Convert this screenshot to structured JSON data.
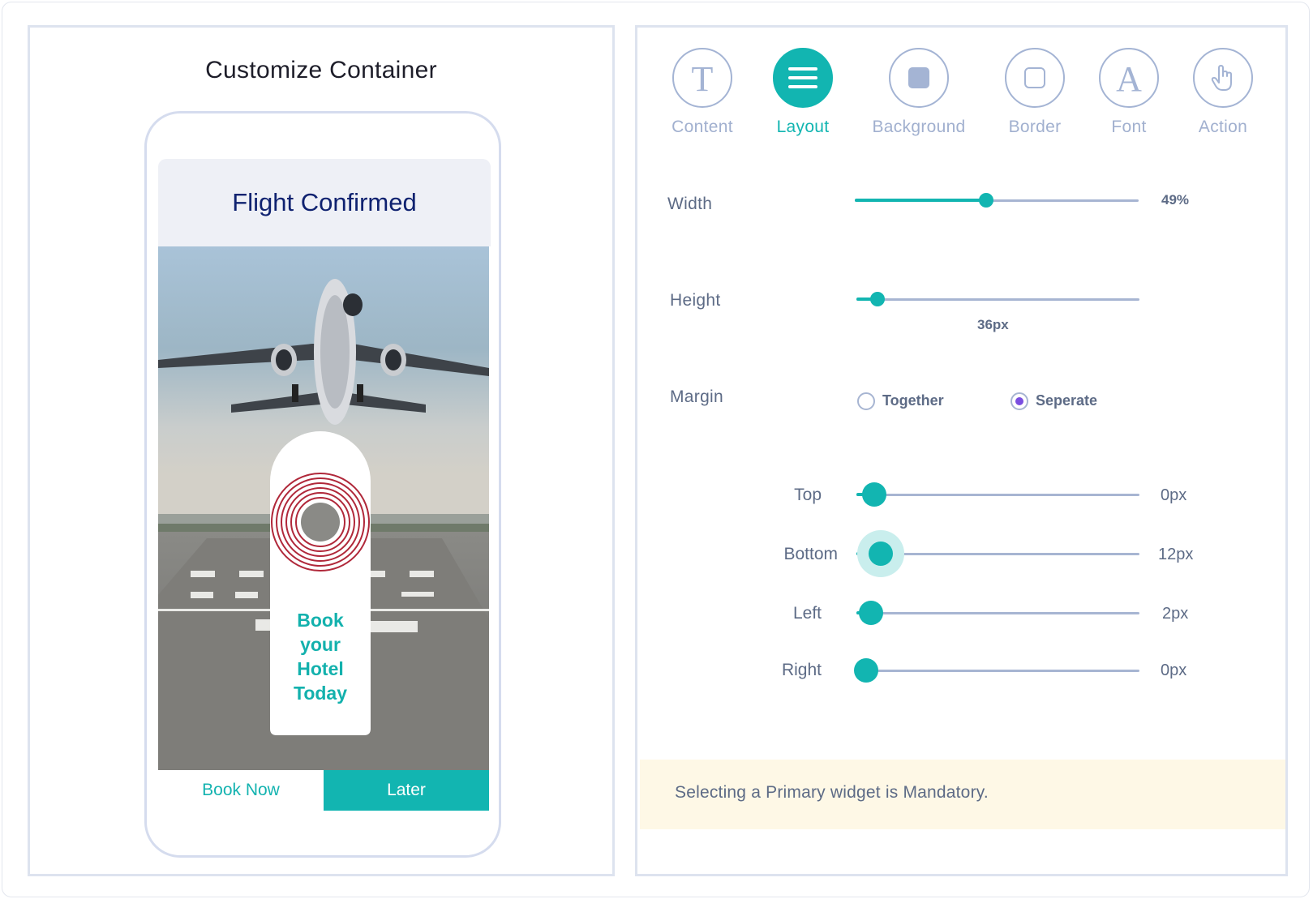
{
  "left": {
    "title": "Customize Container",
    "card": {
      "title": "Flight Confirmed",
      "hanger_lines": [
        "Book",
        "your",
        "Hotel",
        "Today"
      ],
      "primary_button": "Book Now",
      "secondary_button": "Later"
    }
  },
  "tabs": [
    {
      "label": "Content",
      "icon": "text-t-icon",
      "active": false
    },
    {
      "label": "Layout",
      "icon": "menu-lines-icon",
      "active": true
    },
    {
      "label": "Background",
      "icon": "square-fill-icon",
      "active": false
    },
    {
      "label": "Border",
      "icon": "square-outline-icon",
      "active": false
    },
    {
      "label": "Font",
      "icon": "font-a-icon",
      "active": false
    },
    {
      "label": "Action",
      "icon": "hand-pointer-icon",
      "active": false
    }
  ],
  "layout": {
    "width": {
      "label": "Width",
      "value": "49%",
      "level": 0.46
    },
    "height": {
      "label": "Height",
      "value": "36px",
      "level": 0.08
    },
    "margin": {
      "label": "Margin",
      "options": [
        "Together",
        "Seperate"
      ],
      "selected": "Seperate",
      "sides": [
        {
          "label": "Top",
          "value": "0px",
          "level": 0.07
        },
        {
          "label": "Bottom",
          "value": "12px",
          "level": 0.09
        },
        {
          "label": "Left",
          "value": "2px",
          "level": 0.06
        },
        {
          "label": "Right",
          "value": "0px",
          "level": 0.04
        }
      ]
    }
  },
  "notice": "Selecting a Primary widget is Mandatory.",
  "colors": {
    "accent": "#12b5b1",
    "title": "#0f2270",
    "radio": "#7a4ee0",
    "notice_bg": "#fef8e6"
  }
}
